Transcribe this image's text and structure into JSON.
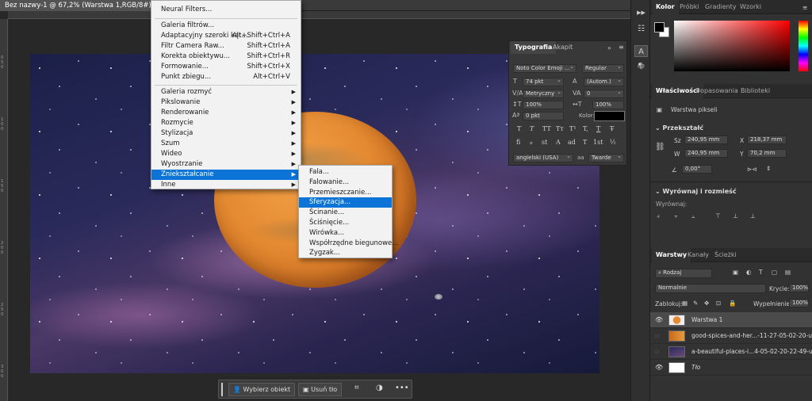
{
  "document": {
    "tab_title": "Bez nazwy-1 @ 67,2% (Warstwa 1,RGB/8#) *",
    "close": "×"
  },
  "rulers": {
    "left_ticks": [
      "0",
      "5",
      "0",
      "1",
      "0",
      "0",
      "1",
      "5",
      "0",
      "2",
      "0",
      "0",
      "2",
      "5",
      "0",
      "3",
      "0",
      "0"
    ]
  },
  "filter_menu": {
    "items": [
      {
        "label": "Neural Filters...",
        "shortcut": ""
      },
      {
        "label": "Galeria filtrów...",
        "shortcut": ""
      },
      {
        "label": "Adaptacyjny szeroki kąt...",
        "shortcut": "Alt+Shift+Ctrl+A"
      },
      {
        "label": "Filtr Camera Raw...",
        "shortcut": "Shift+Ctrl+A"
      },
      {
        "label": "Korekta obiektywu...",
        "shortcut": "Shift+Ctrl+R"
      },
      {
        "label": "Formowanie...",
        "shortcut": "Shift+Ctrl+X"
      },
      {
        "label": "Punkt zbiegu...",
        "shortcut": "Alt+Ctrl+V"
      },
      {
        "label": "Galeria rozmyć",
        "shortcut": ""
      },
      {
        "label": "Pikslowanie",
        "shortcut": ""
      },
      {
        "label": "Renderowanie",
        "shortcut": ""
      },
      {
        "label": "Rozmycie",
        "shortcut": ""
      },
      {
        "label": "Stylizacja",
        "shortcut": ""
      },
      {
        "label": "Szum",
        "shortcut": ""
      },
      {
        "label": "Wideo",
        "shortcut": ""
      },
      {
        "label": "Wyostrzanie",
        "shortcut": ""
      },
      {
        "label": "Zniekształcanie",
        "shortcut": ""
      },
      {
        "label": "Inne",
        "shortcut": ""
      }
    ],
    "arrow": "▶"
  },
  "distort_submenu": {
    "items": [
      "Fala...",
      "Falowanie...",
      "Przemieszczanie...",
      "Sferyzacja...",
      "Ścinanie...",
      "Ściśnięcie...",
      "Wirówka...",
      "Współrzędne biegunowe...",
      "Zygzak..."
    ],
    "selected": "Sferyzacja..."
  },
  "typography_panel": {
    "tabs": [
      "Typografia",
      "Akapit"
    ],
    "font": "Noto Color Emoji ...",
    "style": "Regular",
    "size": "74 pkt",
    "leading": "(Autom.)",
    "kerning": "Metryczny",
    "tracking": "0",
    "v_scale": "100%",
    "h_scale": "100%",
    "baseline": "0 pkt",
    "color_label": "Kolor:",
    "glyph_row1": [
      "T",
      "T",
      "TT",
      "Tт",
      "T¹",
      "T,",
      "T",
      "T̶"
    ],
    "glyph_row2": [
      "fi",
      "ℴ",
      "st",
      "A",
      "ad",
      "T",
      "1st",
      "½"
    ],
    "language": "angielski (USA)",
    "aa": "aa",
    "antialias": "Twarde",
    "icons": {
      "size": "font-size-icon",
      "leading": "leading-icon",
      "kerning": "kerning-icon",
      "tracking": "tracking-icon"
    }
  },
  "mini_toolbar": {
    "tools": [
      "▶▶",
      "☷",
      "◉",
      "▭",
      "A",
      "¶"
    ]
  },
  "color_panel": {
    "tabs": [
      "Kolor",
      "Próbki",
      "Gradienty",
      "Wzorki"
    ]
  },
  "properties_panel": {
    "tabs": [
      "Właściwości",
      "Dopasowania",
      "Biblioteki"
    ],
    "layer_type": "Warstwa pikseli",
    "transform_title": "Przekształć",
    "w_label": "Sz",
    "w": "240,95 mm",
    "h_label": "W",
    "h": "240,95 mm",
    "x_label": "X",
    "x": "218,37 mm",
    "y_label": "Y",
    "y": "70,2 mm",
    "angle": "0,00°",
    "align_title": "Wyrównaj i rozmieść",
    "align_label": "Wyrównaj:"
  },
  "layers_panel": {
    "tabs": [
      "Warstwy",
      "Kanały",
      "Ścieżki"
    ],
    "filter": "Rodzaj",
    "blend": "Normalnie",
    "opacity_label": "Krycie:",
    "opacity": "100%",
    "lock_label": "Zablokuj:",
    "fill_label": "Wypełnienie:",
    "fill": "100%",
    "layers": [
      {
        "name": "Warstwa 1",
        "visible": true,
        "selected": true
      },
      {
        "name": "good-spices-and-her...-11-27-05-02-20-utc",
        "visible": false,
        "selected": false
      },
      {
        "name": "a-beautiful-places-i...4-05-02-20-22-49-utc",
        "visible": false,
        "selected": false
      },
      {
        "name": "Tło",
        "visible": true,
        "selected": false
      }
    ]
  },
  "context_bar": {
    "select_subject": "Wybierz obiekt",
    "remove_bg": "Usuń tło",
    "more": "•••"
  }
}
